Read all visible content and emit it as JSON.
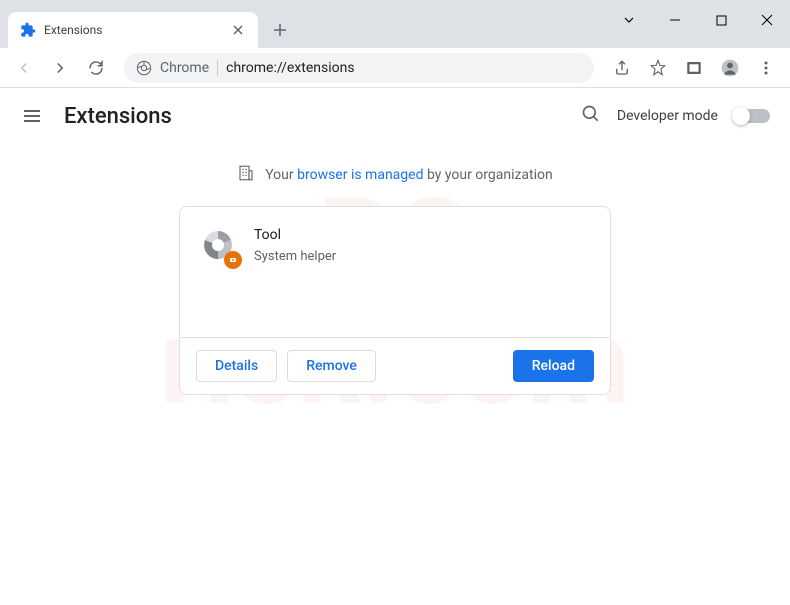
{
  "tab": {
    "title": "Extensions"
  },
  "omnibox": {
    "label": "Chrome",
    "url": "chrome://extensions"
  },
  "header": {
    "title": "Extensions",
    "dev_mode_label": "Developer mode"
  },
  "banner": {
    "prefix": "Your ",
    "link": "browser is managed",
    "suffix": " by your organization"
  },
  "extension": {
    "name": "Tool",
    "description": "System helper",
    "buttons": {
      "details": "Details",
      "remove": "Remove",
      "reload": "Reload"
    }
  }
}
